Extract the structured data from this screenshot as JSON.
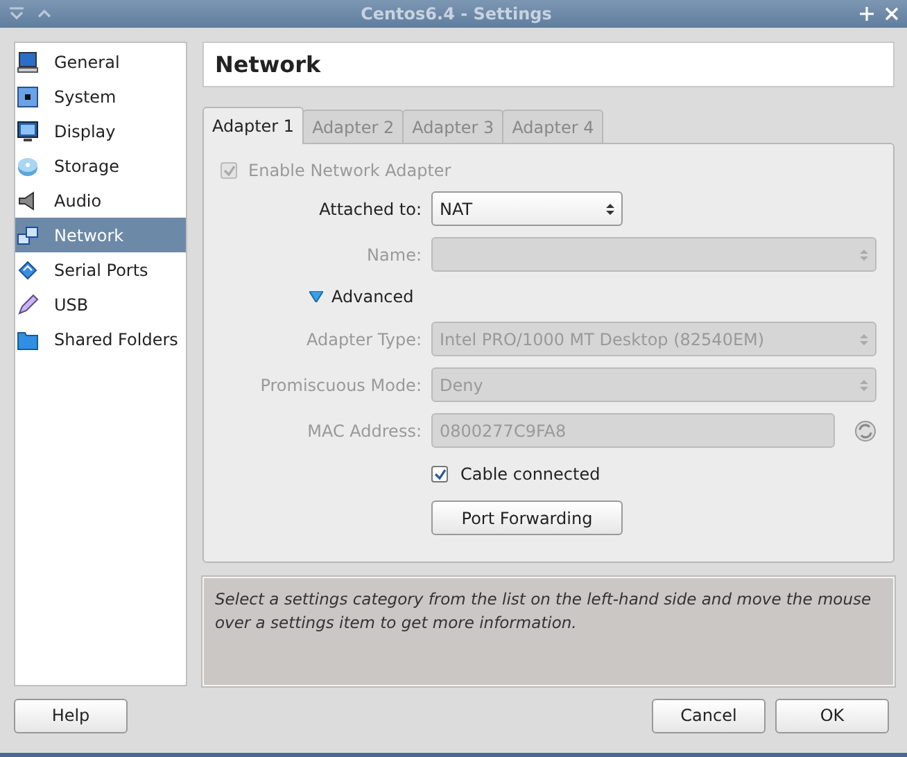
{
  "window": {
    "title": "Centos6.4 - Settings"
  },
  "sidebar": {
    "items": [
      {
        "label": "General",
        "selected": false
      },
      {
        "label": "System",
        "selected": false
      },
      {
        "label": "Display",
        "selected": false
      },
      {
        "label": "Storage",
        "selected": false
      },
      {
        "label": "Audio",
        "selected": false
      },
      {
        "label": "Network",
        "selected": true
      },
      {
        "label": "Serial Ports",
        "selected": false
      },
      {
        "label": "USB",
        "selected": false
      },
      {
        "label": "Shared Folders",
        "selected": false
      }
    ]
  },
  "page": {
    "title": "Network"
  },
  "tabs": [
    {
      "label": "Adapter 1",
      "selected": true
    },
    {
      "label": "Adapter 2",
      "selected": false
    },
    {
      "label": "Adapter 3",
      "selected": false
    },
    {
      "label": "Adapter 4",
      "selected": false
    }
  ],
  "enable_adapter": {
    "label": "Enable Network Adapter",
    "checked": true,
    "disabled": true
  },
  "fields": [
    {
      "kind": "select",
      "label": "Attached to:",
      "value": "NAT",
      "disabled": false
    },
    {
      "kind": "select",
      "label": "Name:",
      "disabled": true
    },
    {
      "kind": "toggle",
      "label": "Advanced",
      "expanded": true
    },
    {
      "kind": "select",
      "label": "Adapter Type:",
      "value": "Intel PRO/1000 MT Desktop (82540EM)",
      "disabled": true
    },
    {
      "kind": "select",
      "label": "Promiscuous Mode:",
      "value": "Deny",
      "disabled": true
    },
    {
      "kind": "text",
      "label": "MAC Address:",
      "value": "0800277C9FA8",
      "disabled": true
    },
    {
      "kind": "checkbox",
      "label": "Cable connected",
      "checked": true
    },
    {
      "kind": "button",
      "label": "Port Forwarding"
    }
  ],
  "description": "Select a settings category from the list on the left-hand side and move the mouse over a settings item to get more information.",
  "buttons": {
    "left": [
      "Help"
    ],
    "right": [
      "Cancel",
      "OK"
    ]
  }
}
